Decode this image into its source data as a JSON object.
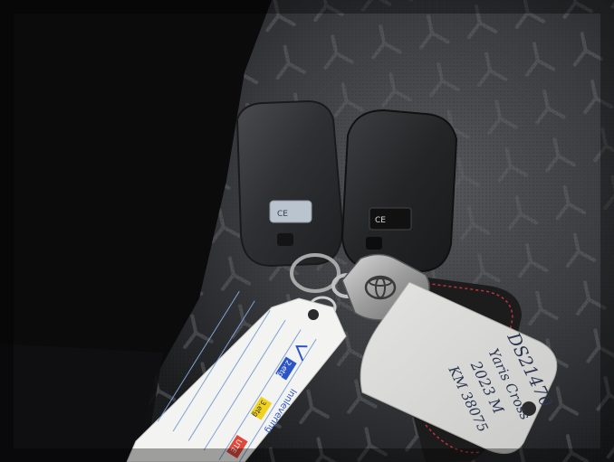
{
  "scene": {
    "description_free": true,
    "colors": {
      "background_dark": "#0b0b0c",
      "seat_fabric": "#3a3b3e",
      "fob_body": "#2a2b2d",
      "tag_paper": "#f2f2f0",
      "blue_tab": "#2c56c8",
      "yellow_tab": "#f0d21e",
      "red_tab": "#e0483c"
    }
  },
  "white_tag": {
    "label_top": "Innlevering",
    "checkbox_1": "2.etg",
    "checkbox_2": "3.etg",
    "checkbox_3": "UTE"
  },
  "grey_tag": {
    "line_1": "DS21470",
    "line_2": "Yaris Cross",
    "line_3": "2023 M",
    "line_4": "KM 38075"
  },
  "fob_left": {
    "label": "CE"
  },
  "fob_right": {
    "label": "CE"
  }
}
